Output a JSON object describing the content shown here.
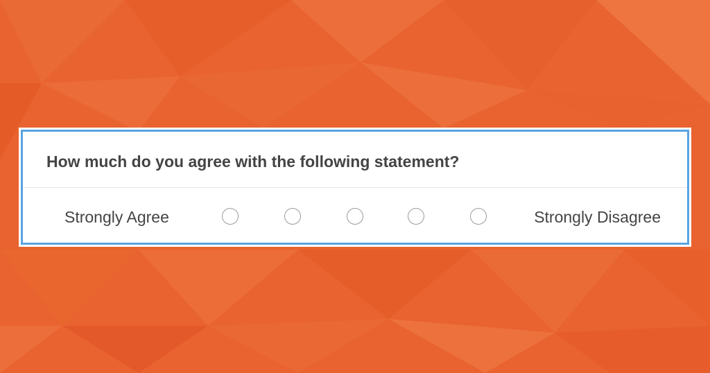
{
  "background": {
    "color": "#e8632f"
  },
  "survey": {
    "question": "How much do you agree with the following statement?",
    "scale": {
      "left_label": "Strongly Agree",
      "right_label": "Strongly Disagree",
      "options": [
        {
          "selected": false
        },
        {
          "selected": false
        },
        {
          "selected": false
        },
        {
          "selected": false
        },
        {
          "selected": false
        }
      ]
    },
    "accent_border_color": "#5aa3e0"
  }
}
